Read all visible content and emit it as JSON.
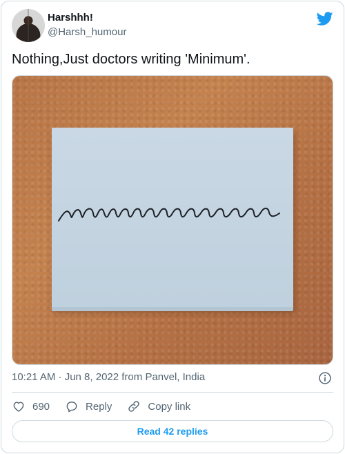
{
  "author": {
    "name": "Harshhh!",
    "handle": "@Harsh_humour"
  },
  "tweet": {
    "text": "Nothing,Just doctors writing 'Minimum'.",
    "image_handwriting": "minimum",
    "timestamp": "10:21 AM · Jun 8, 2022 from Panvel, India"
  },
  "actions": {
    "likes_count": "690",
    "reply_label": "Reply",
    "copy_link_label": "Copy link"
  },
  "replies_button": "Read 42 replies",
  "colors": {
    "brand_blue": "#1d9bf0",
    "secondary_text": "#536471",
    "border": "#cfd9de"
  },
  "icons": [
    "twitter-bird-icon",
    "info-icon",
    "heart-icon",
    "reply-icon",
    "link-icon"
  ]
}
